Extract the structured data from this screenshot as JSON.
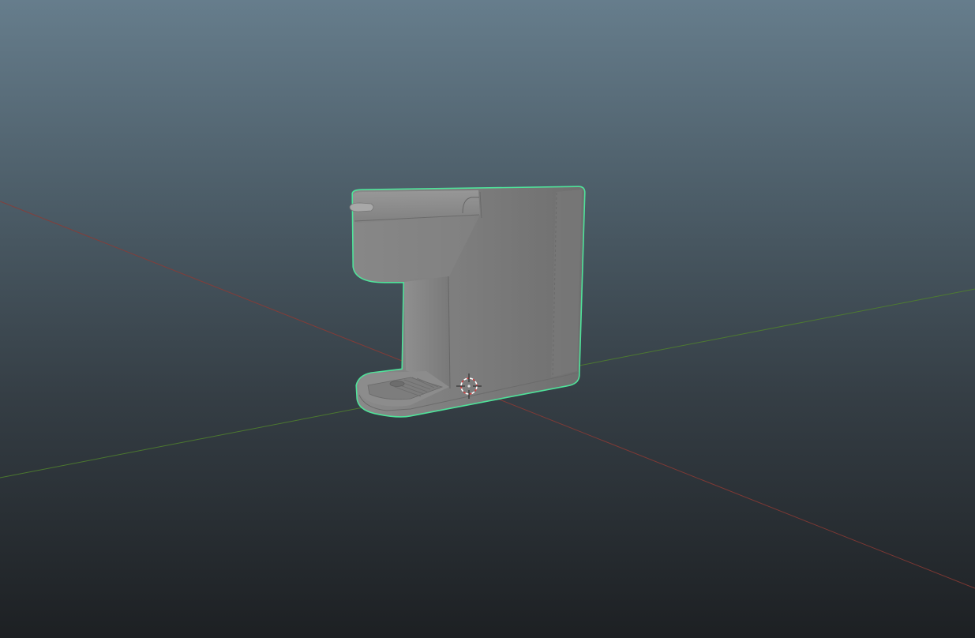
{
  "viewport": {
    "background_top": "#667d8c",
    "background_bottom": "#1d2023",
    "x_axis_color": "#8e3a34",
    "y_axis_color": "#4f7f2e",
    "selection_outline_color": "#4fe39a"
  },
  "scene": {
    "object": "coffee-machine-model",
    "object_selected": true,
    "cursor": "3d-cursor-icon",
    "axes_visible": [
      "x-axis",
      "y-axis"
    ]
  }
}
